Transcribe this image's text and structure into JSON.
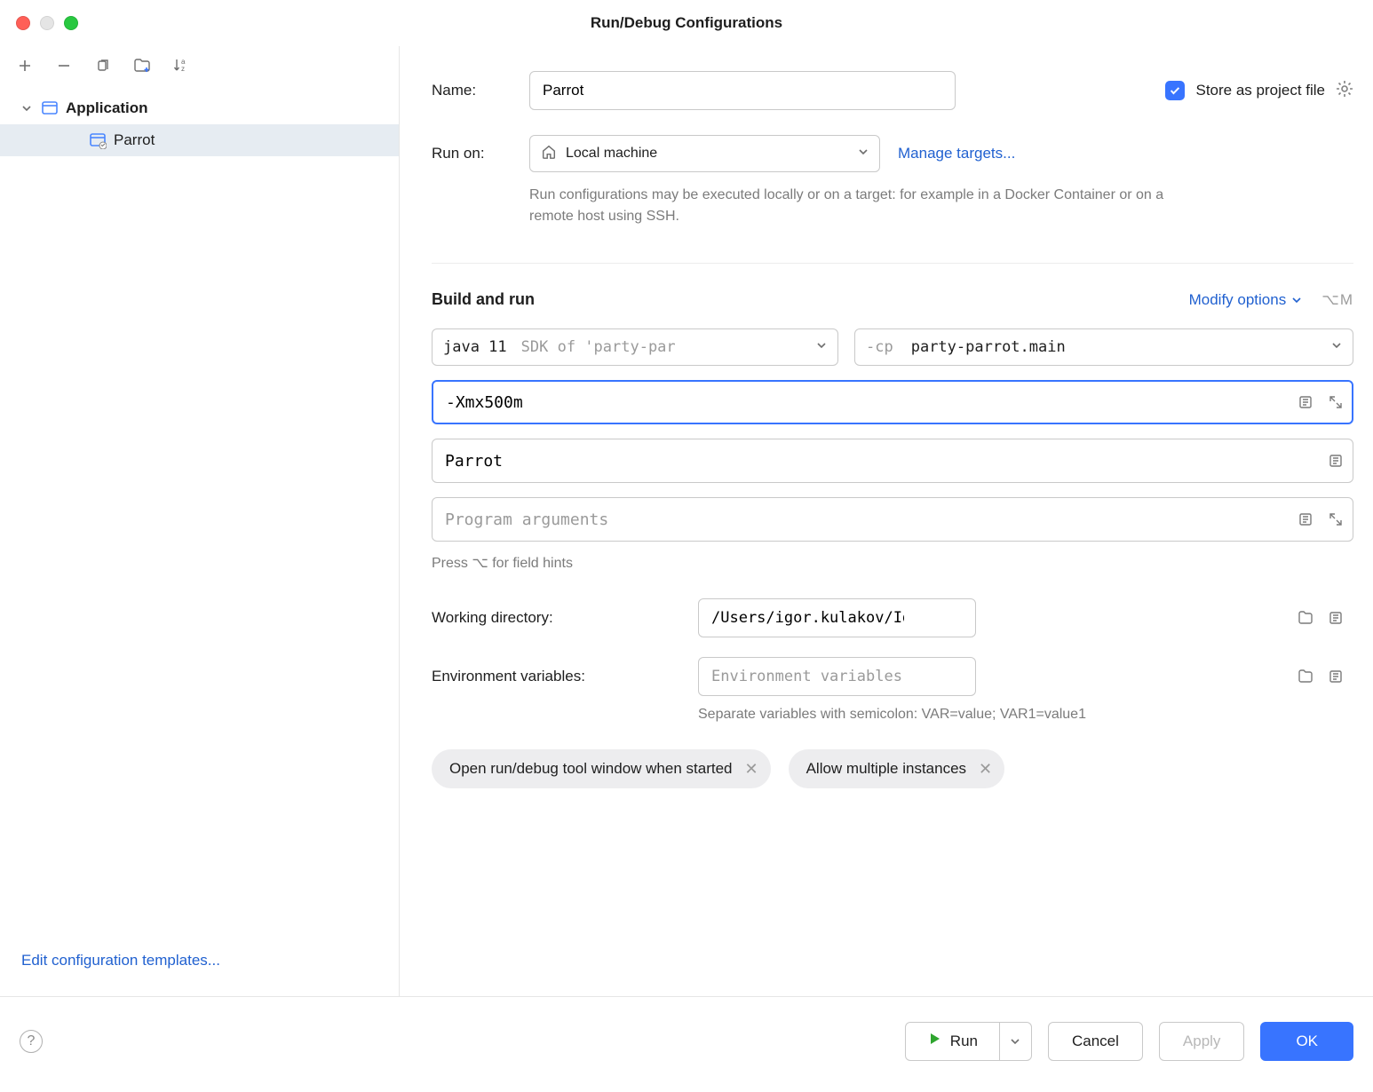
{
  "window_title": "Run/Debug Configurations",
  "sidebar": {
    "tree": {
      "parent_label": "Application",
      "child_label": "Parrot"
    },
    "templates_link": "Edit configuration templates..."
  },
  "form": {
    "name_label": "Name:",
    "name_value": "Parrot",
    "store_label": "Store as project file",
    "run_on_label": "Run on:",
    "run_on_value": "Local machine",
    "manage_targets": "Manage targets...",
    "run_on_hint": "Run configurations may be executed locally or on a target: for example in a Docker Container or on a remote host using SSH."
  },
  "build": {
    "title": "Build and run",
    "modify_label": "Modify options",
    "shortcut": "⌥M",
    "jdk_main": "java 11",
    "jdk_sub": "SDK of 'party-par",
    "cp_prefix": "-cp",
    "cp_value": "party-parrot.main",
    "vm_options": "-Xmx500m",
    "main_class": "Parrot",
    "args_placeholder": "Program arguments",
    "field_hint": "Press ⌥ for field hints",
    "wd_label": "Working directory:",
    "wd_value": "/Users/igor.kulakov/IdeaProjects/party-parrot",
    "env_label": "Environment variables:",
    "env_placeholder": "Environment variables or .env files",
    "env_hint": "Separate variables with semicolon: VAR=value; VAR1=value1"
  },
  "chips": [
    "Open run/debug tool window when started",
    "Allow multiple instances"
  ],
  "footer": {
    "run": "Run",
    "cancel": "Cancel",
    "apply": "Apply",
    "ok": "OK"
  }
}
